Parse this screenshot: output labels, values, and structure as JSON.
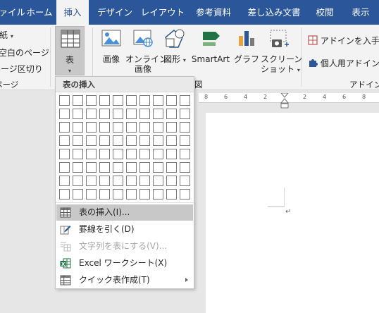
{
  "tabs": [
    {
      "label": "ファイル"
    },
    {
      "label": "ホーム"
    },
    {
      "label": "挿入"
    },
    {
      "label": "デザイン"
    },
    {
      "label": "レイアウト"
    },
    {
      "label": "参考資料"
    },
    {
      "label": "差し込み文書"
    },
    {
      "label": "校閲"
    },
    {
      "label": "表示"
    }
  ],
  "pages_group": {
    "item1": "紙",
    "item2": "空白のページ",
    "item3": "ページ区切り",
    "label": "ページ"
  },
  "table_group": {
    "button_label": "表"
  },
  "illustrations_group": {
    "pictures": "画像",
    "online_pictures_line1": "オンライン",
    "online_pictures_line2": "画像",
    "shapes": "図形",
    "smartart": "SmartArt",
    "chart": "グラフ",
    "screenshot_line1": "スクリーン",
    "screenshot_line2": "ショット",
    "label": "図"
  },
  "addins_group": {
    "get_addins": "アドインを入手",
    "my_addins": "個人用アドイン",
    "label": "アドイン"
  },
  "dropdown": {
    "header": "表の挿入",
    "grid_cols": 10,
    "grid_rows": 8,
    "items": [
      {
        "label": "表の挿入(I)...",
        "icon": "table-icon",
        "highlighted": true,
        "disabled": false
      },
      {
        "label": "罫線を引く(D)",
        "icon": "pencil-icon",
        "highlighted": false,
        "disabled": false
      },
      {
        "label": "文字列を表にする(V)...",
        "icon": "convert-text-icon",
        "highlighted": false,
        "disabled": true
      },
      {
        "label": "Excel ワークシート(X)",
        "icon": "excel-icon",
        "highlighted": false,
        "disabled": false
      },
      {
        "label": "クイック表作成(T)",
        "icon": "quick-table-icon",
        "highlighted": false,
        "disabled": false,
        "submenu": true
      }
    ]
  },
  "ruler": {
    "numbers": [
      "8",
      "6",
      "4",
      "2",
      "2",
      "4",
      "6",
      "8"
    ]
  },
  "colors": {
    "accent": "#2b579a",
    "ribbon": "#f3f3f3",
    "excel": "#217346"
  }
}
